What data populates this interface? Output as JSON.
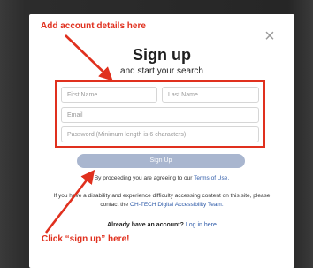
{
  "dialog": {
    "title": "Sign up",
    "subtitle": "and start your search",
    "close_symbol": "×",
    "fields": {
      "first_name_placeholder": "First Name",
      "last_name_placeholder": "Last Name",
      "email_placeholder": "Email",
      "password_placeholder": "Password (Minimum length is 6 characters)"
    },
    "signup_label": "Sign Up",
    "terms_prefix": "By proceeding you are agreeing to our ",
    "terms_link": "Terms of Use.",
    "accessibility_prefix": "If you have a disability and experience difficulty accessing content on this site, please contact the ",
    "accessibility_link": "OH-TECH Digital Accessibility Team.",
    "login_prefix": "Already have an account? ",
    "login_link": "Log in here"
  },
  "annotations": {
    "top_text": "Add account details here",
    "bottom_text": "Click “sign up” here!",
    "color": "#e0301e"
  },
  "colors": {
    "signup_button": "#a9b6cf",
    "link": "#2d5aa8"
  }
}
